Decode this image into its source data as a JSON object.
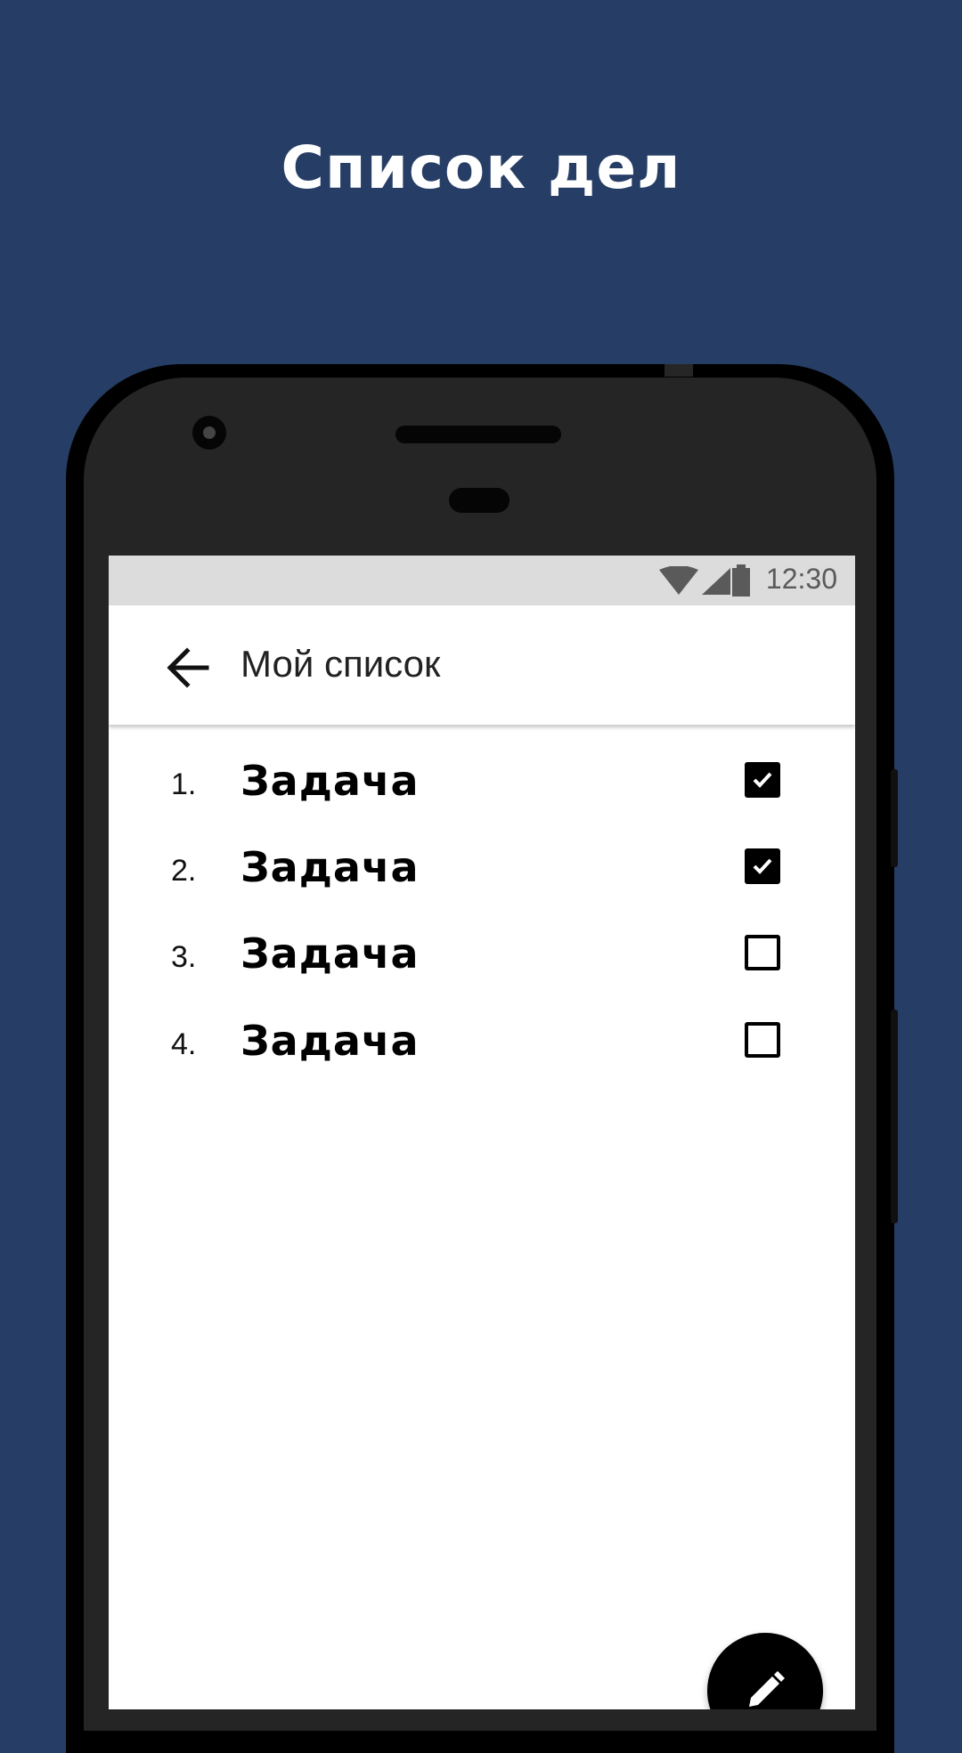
{
  "promo": {
    "headline": "Список дел"
  },
  "status_bar": {
    "time": "12:30",
    "icons": [
      "wifi-icon",
      "signal-icon",
      "battery-icon"
    ]
  },
  "app_bar": {
    "title": "Мой список",
    "back_icon": "arrow-back-icon"
  },
  "tasks": [
    {
      "number": "1.",
      "text": "Задача",
      "checked": true
    },
    {
      "number": "2.",
      "text": "Задача",
      "checked": true
    },
    {
      "number": "3.",
      "text": "Задача",
      "checked": false
    },
    {
      "number": "4.",
      "text": "Задача",
      "checked": false
    }
  ],
  "fab": {
    "icon": "pencil-icon"
  },
  "colors": {
    "background": "#263e66",
    "screen": "#ffffff",
    "status_bar": "#dcdcdc",
    "accent": "#000000"
  }
}
